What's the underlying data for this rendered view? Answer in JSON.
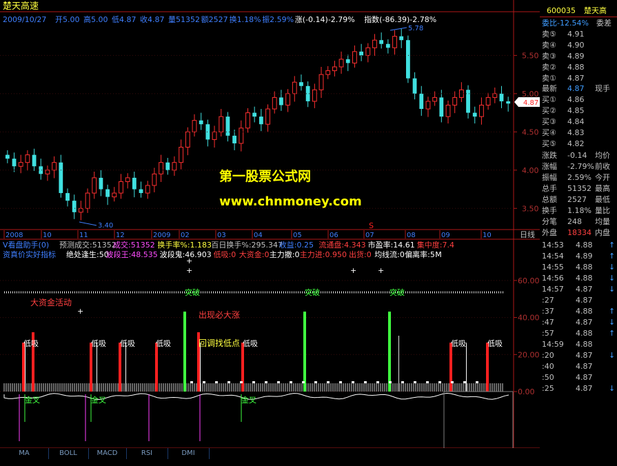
{
  "header": {
    "name": "楚天高速",
    "date": "2009/10/27",
    "fields": [
      "开5.00",
      "高5.00",
      "低4.87",
      "收4.87",
      "量51352",
      "额2527",
      "换1.18%",
      "振2.59%",
      "涨(-0.14)-2.79%",
      "指数(-86.39)-2.78%"
    ]
  },
  "watermark": {
    "line1": "第一股票公式网",
    "line2": "www.chnmoney.com"
  },
  "price_axis": {
    "ticks": [
      "5.50",
      "5.00",
      "4.50",
      "4.00",
      "3.50"
    ],
    "current": "4.87"
  },
  "time_axis": {
    "labels": [
      "2008",
      "10",
      "11",
      "12",
      "2009",
      "02",
      "03",
      "04",
      "05",
      "06",
      "07",
      "08",
      "09",
      "10"
    ],
    "right_label": "日线",
    "marker": "S"
  },
  "annotations": {
    "high": "5.78",
    "low": "3.40"
  },
  "ind1": {
    "title": "V看盘助手(0)",
    "items": [
      {
        "text": "预测成交:51352",
        "color": "#c0c0c0"
      },
      {
        "text": "成交:51352",
        "color": "#ff4dff"
      },
      {
        "text": "换手率%:1.183",
        "color": "#ffff40"
      },
      {
        "text": "百日换手%:295.347",
        "color": "#c0c0c0"
      },
      {
        "text": "收益:0.25",
        "color": "#3f7fff"
      },
      {
        "text": "流通盘:4.343",
        "color": "#ff4040"
      },
      {
        "text": "市盈率:14.61",
        "color": "#ffffff"
      },
      {
        "text": "集中度:7.4",
        "color": "#ff4040"
      }
    ]
  },
  "ind2": {
    "title": "资真价实好指标",
    "items": [
      {
        "text": "绝处逢生:50",
        "color": "#ffffff"
      },
      {
        "text": "波段王:48.535",
        "color": "#ff4dff"
      },
      {
        "text": "波段鬼:46.903",
        "color": "#ffffff"
      },
      {
        "text": "低吸:0",
        "color": "#ff4040"
      },
      {
        "text": "大资金:0",
        "color": "#ff4040"
      },
      {
        "text": "主力撤:0",
        "color": "#ffffff"
      },
      {
        "text": "主力进:0.950",
        "color": "#ff4040"
      },
      {
        "text": "出货:0",
        "color": "#ff4040"
      },
      {
        "text": "均线流:0",
        "color": "#ffffff"
      },
      {
        "text": "偏离率:5",
        "color": "#ffffff"
      },
      {
        "text": "M",
        "color": "#ffffff"
      }
    ]
  },
  "ind_axis": {
    "ticks": [
      "60.00",
      "40.00",
      "20.00",
      "0.00"
    ]
  },
  "signals": {
    "big_funds": "大资金活动",
    "must_rise": "出现必大涨",
    "pullback": "回调找低点",
    "breakout": "突破",
    "buy_low": "低吸",
    "golden_cross": "金叉"
  },
  "tabs": [
    "MA",
    "BOLL",
    "MACD",
    "RSI",
    "DMI"
  ],
  "panel": {
    "code": "600035",
    "name": "楚天高",
    "webi": "委比-12.54%",
    "webi_ext": "委差",
    "sells": [
      {
        "label": "卖⑤",
        "price": "4.91"
      },
      {
        "label": "卖④",
        "price": "4.90"
      },
      {
        "label": "卖③",
        "price": "4.89"
      },
      {
        "label": "卖②",
        "price": "4.88"
      },
      {
        "label": "卖①",
        "price": "4.87"
      }
    ],
    "last": {
      "label": "最新",
      "price": "4.87",
      "ext": "现手"
    },
    "buys": [
      {
        "label": "买①",
        "price": "4.86"
      },
      {
        "label": "买②",
        "price": "4.85"
      },
      {
        "label": "买③",
        "price": "4.84"
      },
      {
        "label": "买④",
        "price": "4.83"
      },
      {
        "label": "买⑤",
        "price": "4.82"
      }
    ],
    "stats": [
      {
        "label": "涨跌",
        "value": "-0.14",
        "ext": "均价"
      },
      {
        "label": "涨幅",
        "value": "-2.79%",
        "ext": "前收"
      },
      {
        "label": "振幅",
        "value": "2.59%",
        "ext": "今开"
      },
      {
        "label": "总手",
        "value": "51352",
        "ext": "最高"
      },
      {
        "label": "总额",
        "value": "2527",
        "ext": "最低"
      },
      {
        "label": "换手",
        "value": "1.18%",
        "ext": "量比"
      },
      {
        "label": "分笔",
        "value": "248",
        "ext": "均量"
      }
    ],
    "outer": {
      "label": "外盘",
      "value": "18334",
      "ext": "内盘"
    },
    "ticks": [
      {
        "time": "14:53",
        "price": "4.88",
        "dir": "↑"
      },
      {
        "time": "14:54",
        "price": "4.89",
        "dir": "↑"
      },
      {
        "time": "14:55",
        "price": "4.88",
        "dir": "↓"
      },
      {
        "time": "14:56",
        "price": "4.88",
        "dir": "↓"
      },
      {
        "time": "14:57",
        "price": "4.87",
        "dir": "↓"
      },
      {
        "time": ":27",
        "price": "4.87",
        "dir": ""
      },
      {
        "time": ":37",
        "price": "4.88",
        "dir": "↑"
      },
      {
        "time": ":47",
        "price": "4.87",
        "dir": "↓"
      },
      {
        "time": ":57",
        "price": "4.88",
        "dir": "↑"
      },
      {
        "time": "14:59",
        "price": "4.88",
        "dir": ""
      },
      {
        "time": ":20",
        "price": "4.87",
        "dir": "↓"
      },
      {
        "time": ":40",
        "price": "4.87",
        "dir": ""
      },
      {
        "time": ":50",
        "price": "4.87",
        "dir": ""
      },
      {
        "time": ":25",
        "price": "4.87",
        "dir": "↓"
      }
    ]
  },
  "chart_data": {
    "type": "candlestick",
    "ylim": [
      3.25,
      5.9
    ],
    "period": "日线",
    "series": [
      {
        "name": "close",
        "values": [
          4.15,
          4.05,
          4.1,
          4.2,
          4.05,
          3.95,
          4.0,
          4.1,
          3.7,
          3.6,
          3.45,
          3.5,
          3.7,
          3.9,
          3.75,
          3.65,
          3.7,
          3.85,
          3.9,
          3.75,
          3.7,
          3.8,
          3.95,
          4.1,
          4.0,
          4.1,
          4.3,
          4.5,
          4.65,
          4.6,
          4.4,
          4.5,
          4.7,
          4.45,
          4.35,
          4.55,
          4.75,
          4.7,
          4.6,
          4.8,
          4.95,
          4.85,
          5.0,
          5.15,
          5.1,
          4.9,
          5.05,
          5.25,
          5.3,
          5.35,
          5.45,
          5.4,
          5.55,
          5.5,
          5.6,
          5.7,
          5.65,
          5.6,
          5.75,
          5.7,
          5.2,
          5.0,
          4.8,
          4.9,
          4.95,
          4.7,
          4.85,
          4.95,
          5.05,
          4.75,
          4.7,
          4.85,
          4.95,
          5.0,
          4.9,
          4.87
        ]
      }
    ],
    "indicator_ylim": [
      0,
      70
    ]
  }
}
